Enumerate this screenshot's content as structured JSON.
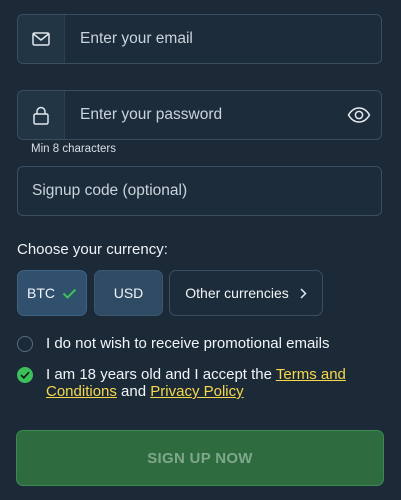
{
  "form": {
    "email": {
      "placeholder": "Enter your email",
      "icon": "envelope-icon"
    },
    "password": {
      "placeholder": "Enter your password",
      "icon": "lock-icon",
      "toggle_icon": "eye-icon",
      "hint": "Min 8 characters"
    },
    "signup_code": {
      "placeholder": "Signup code (optional)"
    }
  },
  "currency": {
    "label": "Choose your currency:",
    "options": [
      {
        "label": "BTC",
        "selected": true
      },
      {
        "label": "USD",
        "selected": false
      },
      {
        "label": "Other currencies",
        "selected": false
      }
    ]
  },
  "consents": {
    "promo": {
      "text": "I do not wish to receive promotional emails",
      "checked": false
    },
    "age": {
      "text_prefix": "I am 18 years old and I accept the ",
      "terms_link": "Terms and Conditions",
      "and_text": " and ",
      "privacy_link": "Privacy Policy",
      "checked": true
    }
  },
  "submit": {
    "label": "SIGN UP NOW"
  },
  "colors": {
    "background": "#1c2a38",
    "accent_green": "#3cc05a",
    "link_yellow": "#f5d94a",
    "button_green": "#2e6b3f"
  }
}
